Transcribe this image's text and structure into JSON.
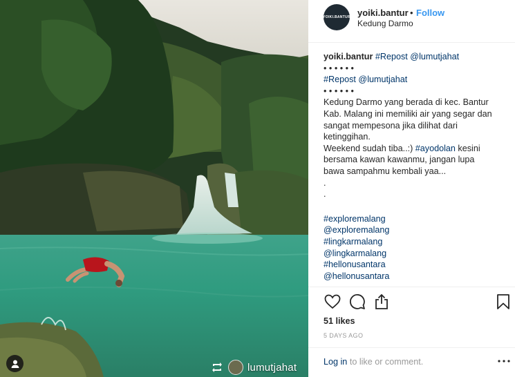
{
  "post": {
    "username": "yoiki.bantur",
    "avatar_text": "YOIKI.BANTUR",
    "separator": "•",
    "follow_label": "Follow",
    "location": "Kedung Darmo"
  },
  "caption": {
    "lines": [
      {
        "type": "head",
        "user": "yoiki.bantur",
        "text": "#Repost @lumutjahat"
      },
      {
        "type": "text",
        "text": "• • • • • •"
      },
      {
        "type": "link",
        "text": "#Repost @lumutjahat"
      },
      {
        "type": "text",
        "text": "• • • • • •"
      },
      {
        "type": "text",
        "text": "Kedung Darmo yang berada di kec. Bantur"
      },
      {
        "type": "text",
        "text": "Kab. Malang ini memiliki air yang segar dan"
      },
      {
        "type": "text",
        "text": "sangat mempesona jika dilihat dari"
      },
      {
        "type": "text",
        "text": "ketinggihan."
      },
      {
        "type": "text",
        "text": "Weekend sudah tiba..:)",
        "link": "#ayodolan",
        "rest": " kesini"
      },
      {
        "type": "text",
        "text": "bersama kawan kawanmu, jangan lupa"
      },
      {
        "type": "text",
        "text": "bawa sampahmu kembali yaa..."
      },
      {
        "type": "text",
        "text": "."
      },
      {
        "type": "text",
        "text": "."
      },
      {
        "type": "gap"
      },
      {
        "type": "link",
        "text": "#exploremalang"
      },
      {
        "type": "link",
        "text": "@exploremalang"
      },
      {
        "type": "link",
        "text": "#lingkarmalang"
      },
      {
        "type": "link",
        "text": "@lingkarmalang"
      },
      {
        "type": "link",
        "text": "#hellonusantara"
      },
      {
        "type": "link",
        "text": "@hellonusantara"
      }
    ]
  },
  "actions": {
    "like_icon": "heart-icon",
    "comment_icon": "comment-icon",
    "share_icon": "share-icon",
    "save_icon": "bookmark-icon"
  },
  "likes": "51 likes",
  "date": "5 DAYS AGO",
  "comment": {
    "login_label": "Log in",
    "rest": " to like or comment.",
    "more_icon": "more-options-icon"
  },
  "photo": {
    "repost_user": "lumutjahat",
    "repost_icon": "repost-icon",
    "user_tag_icon": "person-icon"
  },
  "colors": {
    "accent": "#3897f0",
    "link": "#003569",
    "muted": "#999999",
    "text": "#262626"
  }
}
